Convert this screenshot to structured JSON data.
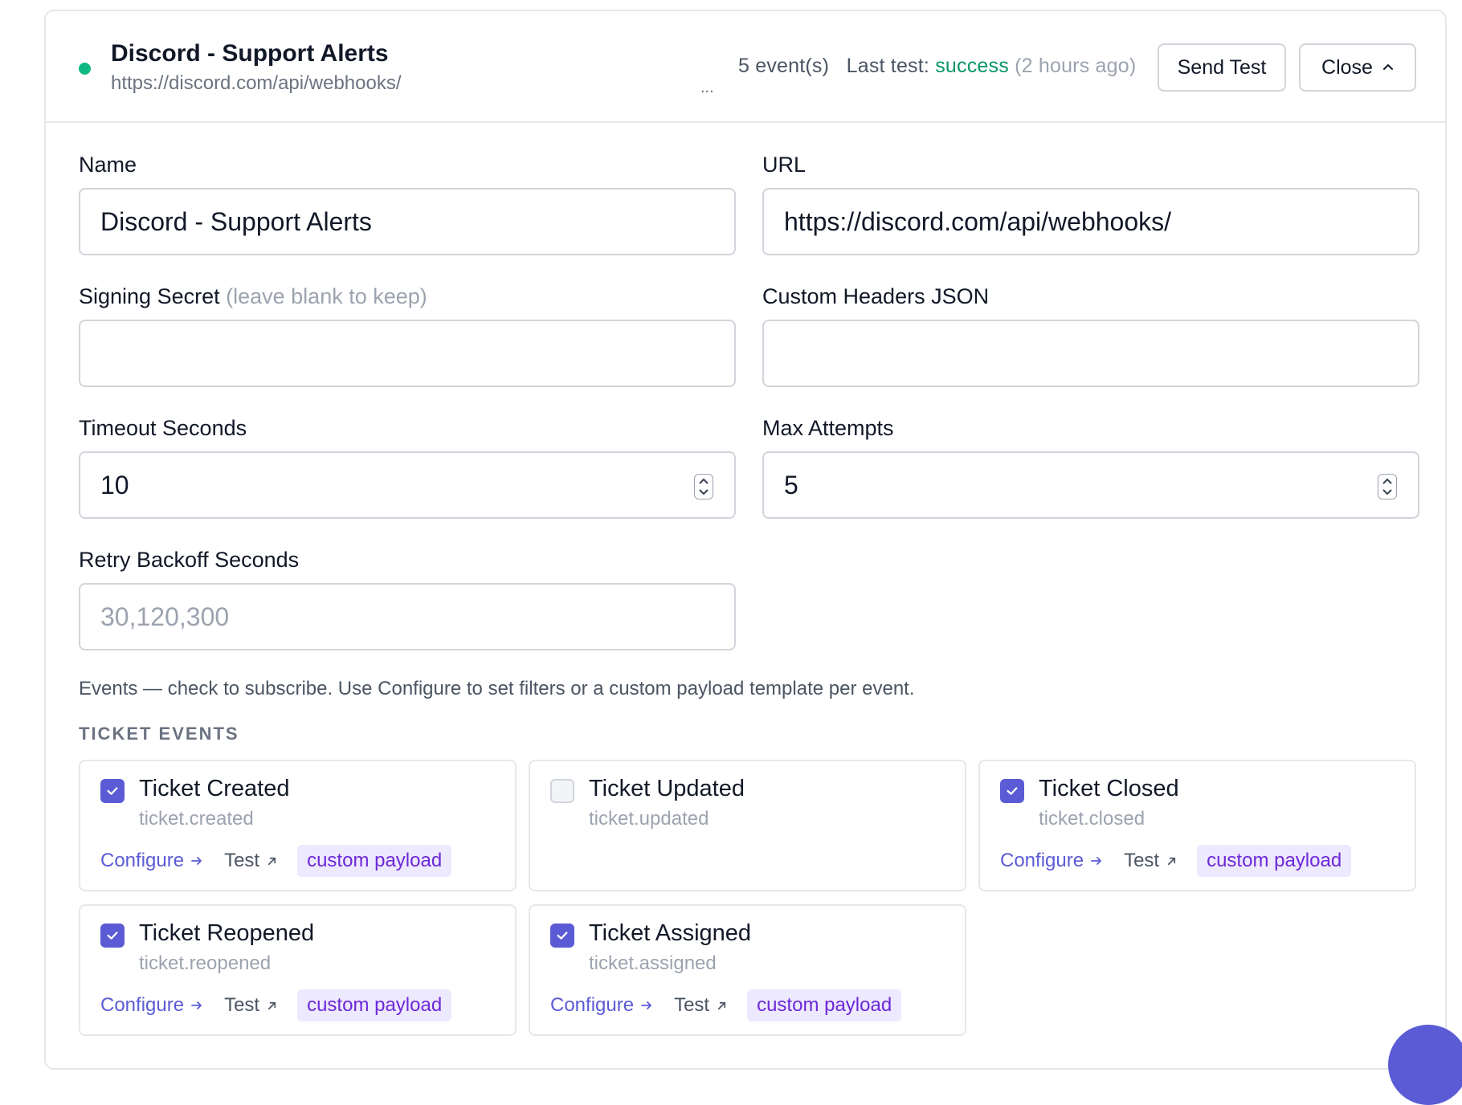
{
  "header": {
    "status_color": "#10b981",
    "name": "Discord - Support Alerts",
    "url": "https://discord.com/api/webhooks/",
    "ellipsis": "...",
    "events_count": "5 event(s)",
    "last_test_label": "Last test:",
    "last_test_status": "success",
    "last_test_ago": "(2 hours ago)",
    "send_test_label": "Send Test",
    "close_label": "Close"
  },
  "form": {
    "name_label": "Name",
    "name_value": "Discord - Support Alerts",
    "url_label": "URL",
    "url_value": "https://discord.com/api/webhooks/",
    "secret_label": "Signing Secret",
    "secret_hint": "(leave blank to keep)",
    "secret_value": "",
    "headers_label": "Custom Headers JSON",
    "headers_value": "",
    "timeout_label": "Timeout Seconds",
    "timeout_value": "10",
    "attempts_label": "Max Attempts",
    "attempts_value": "5",
    "backoff_label": "Retry Backoff Seconds",
    "backoff_placeholder": "30,120,300"
  },
  "events": {
    "intro": "Events — check to subscribe. Use Configure to set filters or a custom payload template per event.",
    "section_title": "TICKET EVENTS",
    "configure_label": "Configure",
    "test_label": "Test",
    "payload_badge": "custom payload",
    "items": [
      {
        "title": "Ticket Created",
        "key": "ticket.created",
        "checked": true
      },
      {
        "title": "Ticket Updated",
        "key": "ticket.updated",
        "checked": false
      },
      {
        "title": "Ticket Closed",
        "key": "ticket.closed",
        "checked": true
      },
      {
        "title": "Ticket Reopened",
        "key": "ticket.reopened",
        "checked": true
      },
      {
        "title": "Ticket Assigned",
        "key": "ticket.assigned",
        "checked": true
      }
    ]
  },
  "colors": {
    "accent": "#5b5bd6",
    "success": "#059669",
    "badge_bg": "#ede9fe",
    "badge_text": "#6d28d9"
  },
  "icons": [
    "status-dot",
    "chevron-up-icon",
    "spinner-icon",
    "checkbox-icon",
    "arrow-right-icon",
    "arrow-up-right-icon"
  ]
}
